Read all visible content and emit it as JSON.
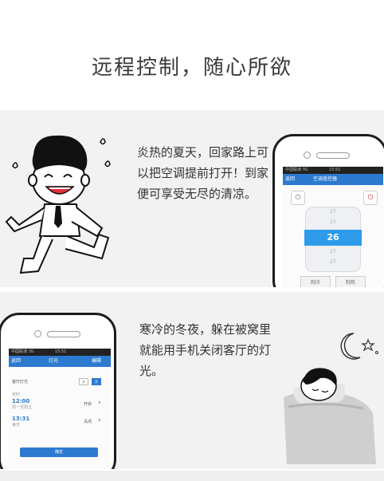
{
  "page": {
    "title": "远程控制，随心所欲"
  },
  "section_summer": {
    "caption": "炎热的夏天，回家路上可以把空调提前打开！到家便可享受无尽的清凉。",
    "phone": {
      "status_text": "中国联通 3G",
      "status_time": "15:51",
      "appbar_back": "返回",
      "appbar_title": "空调遥控器",
      "temps": [
        "27",
        "27",
        "26",
        "27",
        "27"
      ],
      "selected_temp": "26",
      "mode_left": "制冷",
      "mode_right": "制热"
    }
  },
  "section_winter": {
    "caption": "寒冷的冬夜，躲在被窝里就能用手机关闭客厅的灯光。",
    "phone": {
      "status_text": "中国联通 3G",
      "status_time": "15:51",
      "appbar_back": "返回",
      "appbar_title": "灯光",
      "appbar_edit": "编辑",
      "lamp_name": "客厅灯光",
      "toggle_off": "关",
      "toggle_on": "开",
      "timer_label": "定时",
      "timer1_time": "12:00",
      "timer1_sub": "周一至周五",
      "timer1_state": "开启",
      "timer2_time": "13:31",
      "timer2_sub": "每天",
      "timer2_state": "关闭",
      "confirm": "确定"
    }
  }
}
